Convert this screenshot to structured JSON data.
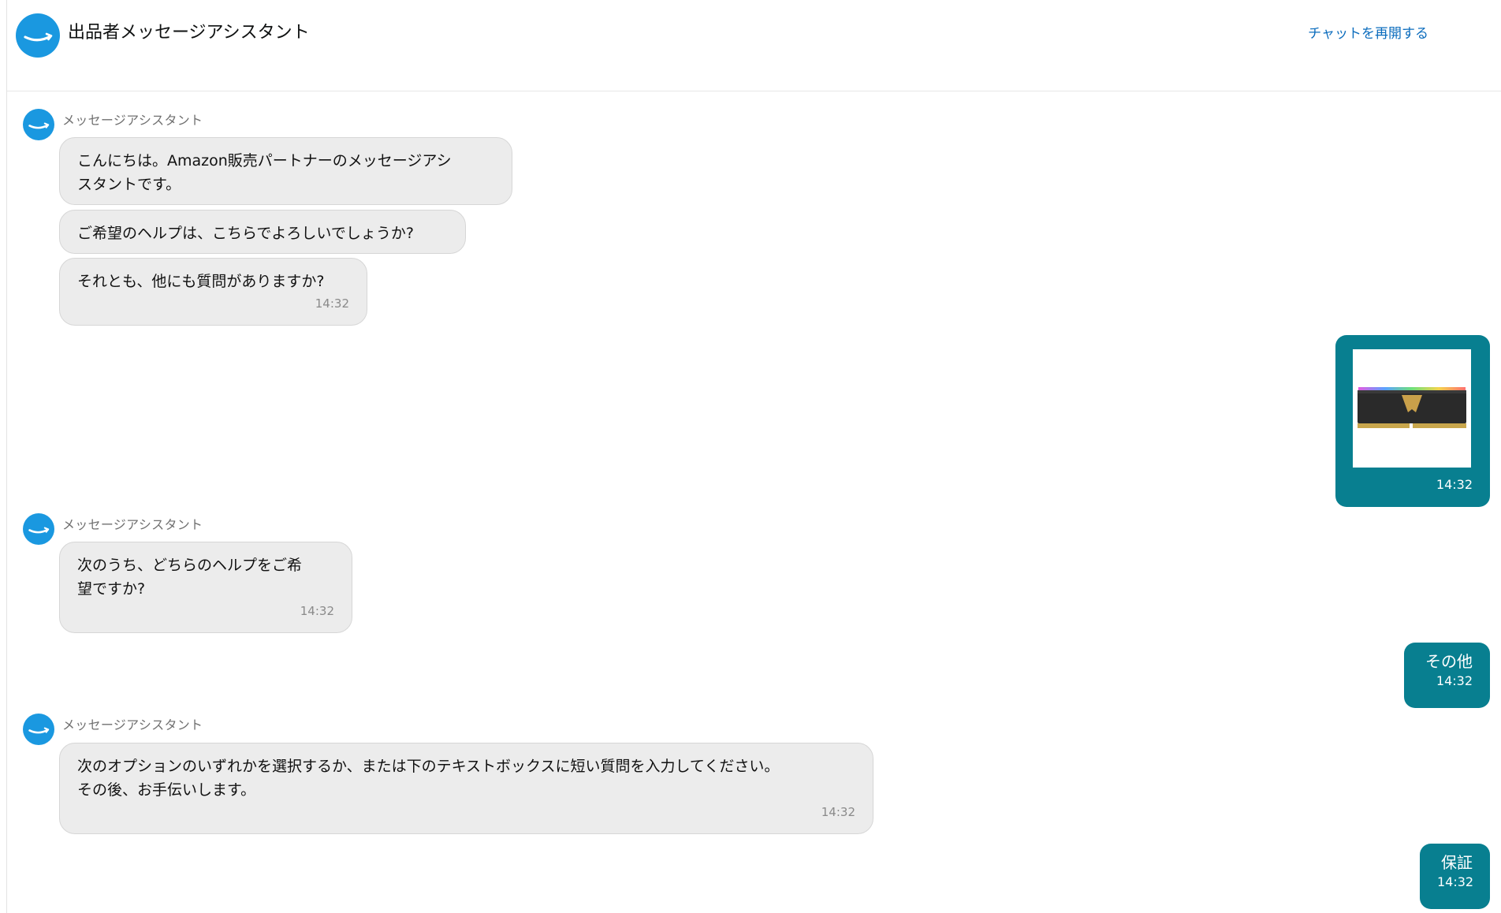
{
  "header": {
    "title": "出品者メッセージアシスタント",
    "reopen_link": "チャットを再開する",
    "logo_icon": "amazon-smile-logo"
  },
  "colors": {
    "brand_blue": "#1a98e0",
    "user_bubble": "#087f90",
    "bot_bubble": "#ececec",
    "link": "#0b6cbd"
  },
  "messages": [
    {
      "role": "bot",
      "sender": "メッセージアシスタント",
      "bubbles": [
        "こんにちは。Amazon販売パートナーのメッセージアシ\nスタントです。",
        "ご希望のヘルプは、こちらでよろしいでしょうか?",
        "それとも、他にも質問がありますか?"
      ],
      "time": "14:32"
    },
    {
      "role": "user",
      "type": "image",
      "image_alt": "RGB memory module product image",
      "time": "14:32"
    },
    {
      "role": "bot",
      "sender": "メッセージアシスタント",
      "bubbles": [
        "次のうち、どちらのヘルプをご希\n望ですか?"
      ],
      "time": "14:32"
    },
    {
      "role": "user",
      "type": "text",
      "text": "その他",
      "time": "14:32"
    },
    {
      "role": "bot",
      "sender": "メッセージアシスタント",
      "bubbles": [
        "次のオプションのいずれかを選択するか、または下のテキストボックスに短い質問を入力してください。\nその後、お手伝いします。"
      ],
      "time": "14:32"
    },
    {
      "role": "user",
      "type": "text",
      "text": "保証",
      "time": "14:32"
    }
  ]
}
